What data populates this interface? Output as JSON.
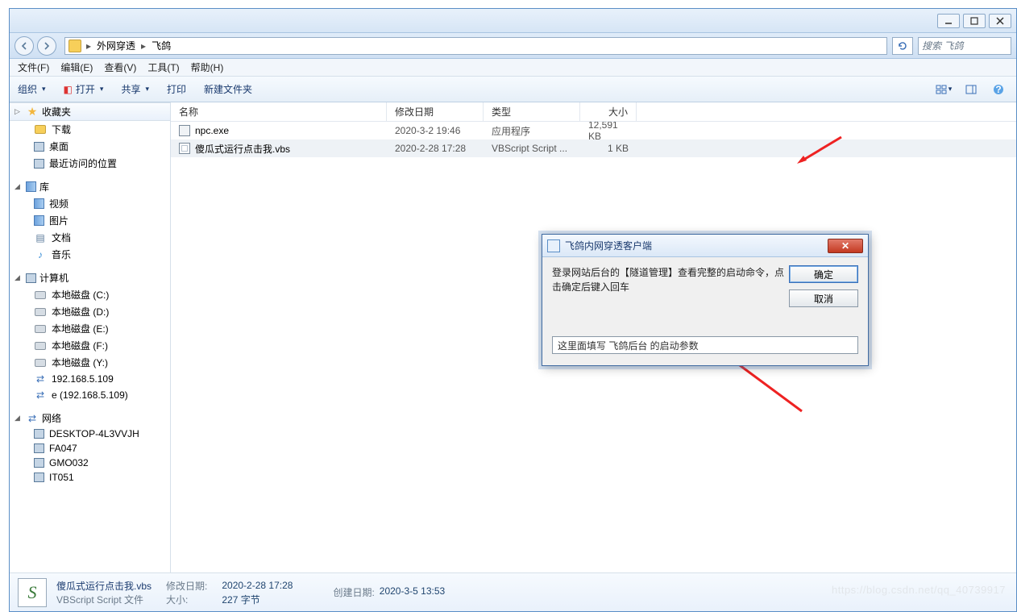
{
  "titlebar": {},
  "crumbs": {
    "seg1": "外网穿透",
    "seg2": "飞鸽"
  },
  "search": {
    "placeholder": "搜索 飞鸽"
  },
  "menu": {
    "file": "文件(F)",
    "edit": "编辑(E)",
    "view": "查看(V)",
    "tools": "工具(T)",
    "help": "帮助(H)"
  },
  "toolbar": {
    "org": "组织",
    "open": "打开",
    "share": "共享",
    "print": "打印",
    "new": "新建文件夹"
  },
  "sidebar": {
    "fav": {
      "label": "收藏夹",
      "items": [
        "下载",
        "桌面",
        "最近访问的位置"
      ]
    },
    "lib": {
      "label": "库",
      "items": [
        "视频",
        "图片",
        "文档",
        "音乐"
      ]
    },
    "comp": {
      "label": "计算机",
      "items": [
        "本地磁盘 (C:)",
        "本地磁盘 (D:)",
        "本地磁盘 (E:)",
        "本地磁盘 (F:)",
        "本地磁盘 (Y:)",
        "192.168.5.109",
        "e (192.168.5.109)"
      ]
    },
    "net": {
      "label": "网络",
      "items": [
        "DESKTOP-4L3VVJH",
        "FA047",
        "GMO032",
        "IT051"
      ]
    }
  },
  "cols": {
    "name": "名称",
    "date": "修改日期",
    "type": "类型",
    "size": "大小"
  },
  "files": [
    {
      "name": "npc.exe",
      "date": "2020-3-2 19:46",
      "type": "应用程序",
      "size": "12,591 KB"
    },
    {
      "name": "傻瓜式运行点击我.vbs",
      "date": "2020-2-28 17:28",
      "type": "VBScript Script ...",
      "size": "1 KB"
    }
  ],
  "detail": {
    "name": "傻瓜式运行点击我.vbs",
    "sub": "VBScript Script 文件",
    "mod_lbl": "修改日期:",
    "mod_val": "2020-2-28 17:28",
    "size_lbl": "大小:",
    "size_val": "227 字节",
    "crt_lbl": "创建日期:",
    "crt_val": "2020-3-5 13:53"
  },
  "dialog": {
    "title": "飞鸽内网穿透客户端",
    "msg": "登录网站后台的【隧道管理】查看完整的启动命令，点击确定后键入回车",
    "ok": "确定",
    "cancel": "取消",
    "input": "这里面填写 飞鸽后台 的启动参数"
  },
  "watermark": "https://blog.csdn.net/qq_40739917"
}
